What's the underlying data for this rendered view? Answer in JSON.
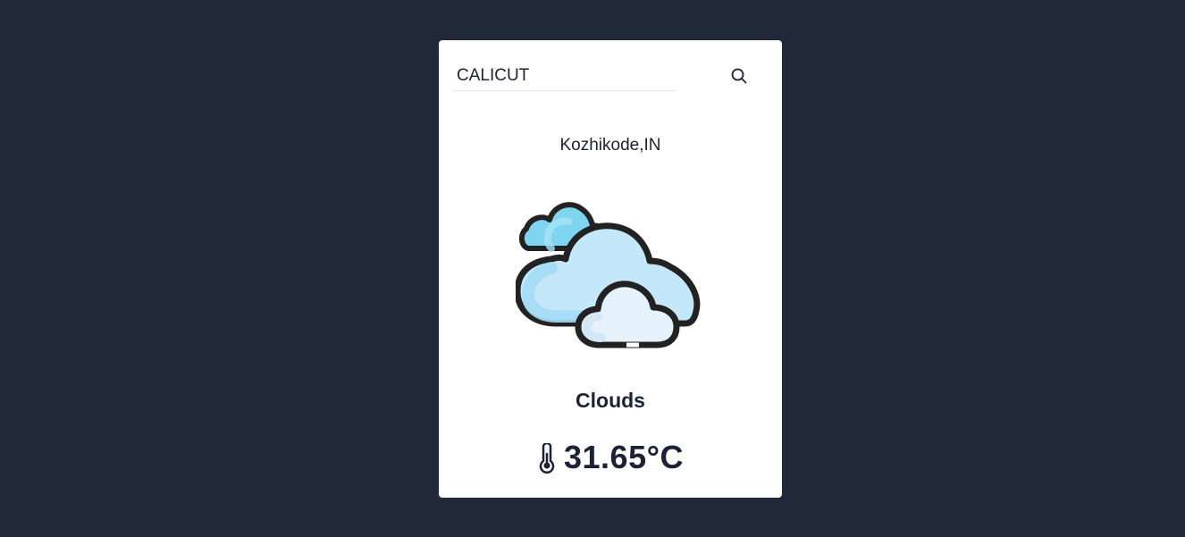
{
  "search": {
    "value": "CALICUT",
    "icon": "search-icon"
  },
  "weather": {
    "location": "Kozhikode,IN",
    "icon": "clouds-icon",
    "condition": "Clouds",
    "temperature": "31.65°C",
    "temperature_icon": "thermometer-icon"
  },
  "colors": {
    "background": "#212838",
    "card": "#ffffff",
    "text": "#1b2233"
  }
}
